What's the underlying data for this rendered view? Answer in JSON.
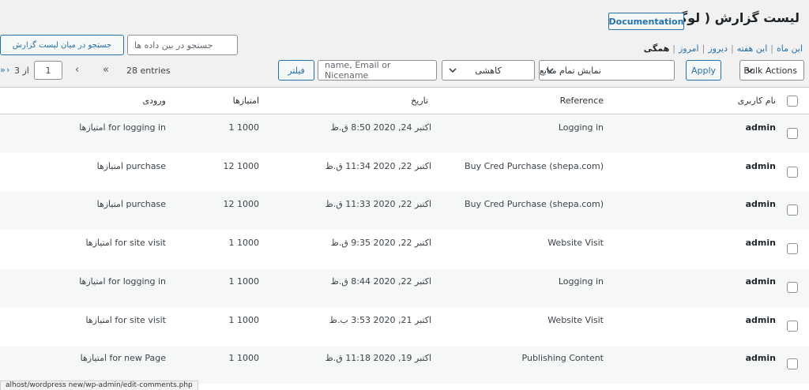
{
  "page": {
    "title": "لیست گزارش ( لوگ )",
    "documentation_label": "Documentation"
  },
  "views": {
    "all": "همگی",
    "today": "امروز",
    "yesterday": "دیروز",
    "this_week": "این هفته",
    "this_month": "این ماه",
    "sep": "|"
  },
  "search": {
    "placeholder": "جستجو در بین داده ها",
    "button_label": "جستجو در میان لیست گزارش"
  },
  "toolbar": {
    "bulk_actions": "Bulk Actions",
    "apply": "Apply",
    "source_filter": "نمایش تمام منابع",
    "order": "کاهشی",
    "user_filter_placeholder": "name, Email or Nicename",
    "filter_button": "فیلتر"
  },
  "pagination": {
    "entries": "28 entries",
    "first": "«",
    "prev": "‹",
    "current_page": "1",
    "of_label": "از 3",
    "next": "›",
    "last": "»"
  },
  "table": {
    "headers": {
      "username": "نام کاربری",
      "reference": "Reference",
      "date": "تاریخ",
      "points": "امتیازها",
      "entry": "ورودی"
    },
    "rows": [
      {
        "user": "admin",
        "reference": "Logging in",
        "date": "اکتبر 24, 2020 8:50 ق.ظ",
        "points": "1 1000",
        "entry": "امتیازها for logging in"
      },
      {
        "user": "admin",
        "reference": "Buy Cred Purchase (shepa.com)",
        "date": "اکتبر 22, 2020 11:34 ق.ظ",
        "points": "12 1000",
        "entry": "امتیازها purchase"
      },
      {
        "user": "admin",
        "reference": "Buy Cred Purchase (shepa.com)",
        "date": "اکتبر 22, 2020 11:33 ق.ظ",
        "points": "12 1000",
        "entry": "امتیازها purchase"
      },
      {
        "user": "admin",
        "reference": "Website Visit",
        "date": "اکتبر 22, 2020 9:35 ق.ظ",
        "points": "1 1000",
        "entry": "امتیازها for site visit"
      },
      {
        "user": "admin",
        "reference": "Logging in",
        "date": "اکتبر 22, 2020 8:44 ق.ظ",
        "points": "1 1000",
        "entry": "امتیازها for logging in"
      },
      {
        "user": "admin",
        "reference": "Website Visit",
        "date": "اکتبر 21, 2020 3:53 ب.ظ",
        "points": "1 1000",
        "entry": "امتیازها for site visit"
      },
      {
        "user": "admin",
        "reference": "Publishing Content",
        "date": "اکتبر 19, 2020 11:18 ق.ظ",
        "points": "1 1000",
        "entry": "امتیازها for new Page"
      }
    ]
  },
  "statusbar": {
    "url": "alhost/wordpress new/wp-admin/edit-comments.php"
  }
}
